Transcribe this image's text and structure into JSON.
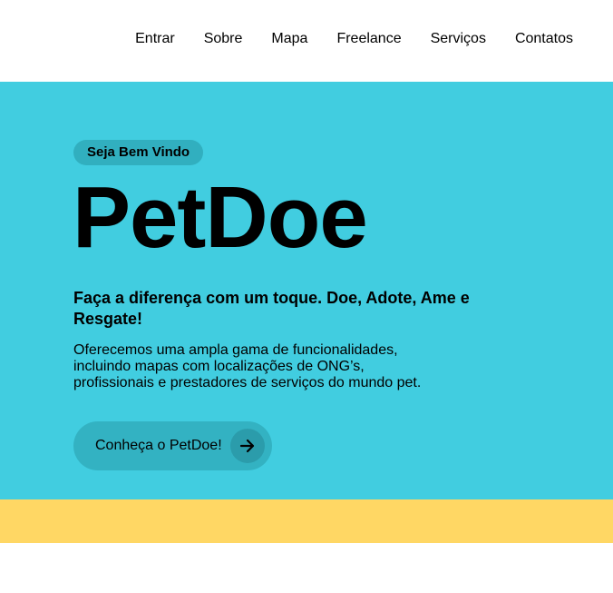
{
  "nav": {
    "items": [
      {
        "label": "Entrar"
      },
      {
        "label": "Sobre"
      },
      {
        "label": "Mapa"
      },
      {
        "label": "Freelance"
      },
      {
        "label": "Serviços"
      },
      {
        "label": "Contatos"
      }
    ]
  },
  "hero": {
    "badge": "Seja Bem Vindo",
    "title": "PetDoe",
    "tagline": "Faça a diferença com um toque. Doe, Adote, Ame e Resgate!",
    "description": "Oferecemos uma ampla gama de funcionalidades, incluindo mapas com localizações de ONG’s, profissionais e prestadores de serviços do mundo pet.",
    "cta_label": "Conheça o PetDoe!",
    "cta_icon": "arrow-right-icon"
  },
  "colors": {
    "hero_bg": "#41cde0",
    "badge_bg": "#31afbf",
    "button_bg": "#33b2c2",
    "arrow_bg": "#2b9cab",
    "band_bg": "#ffd764"
  }
}
